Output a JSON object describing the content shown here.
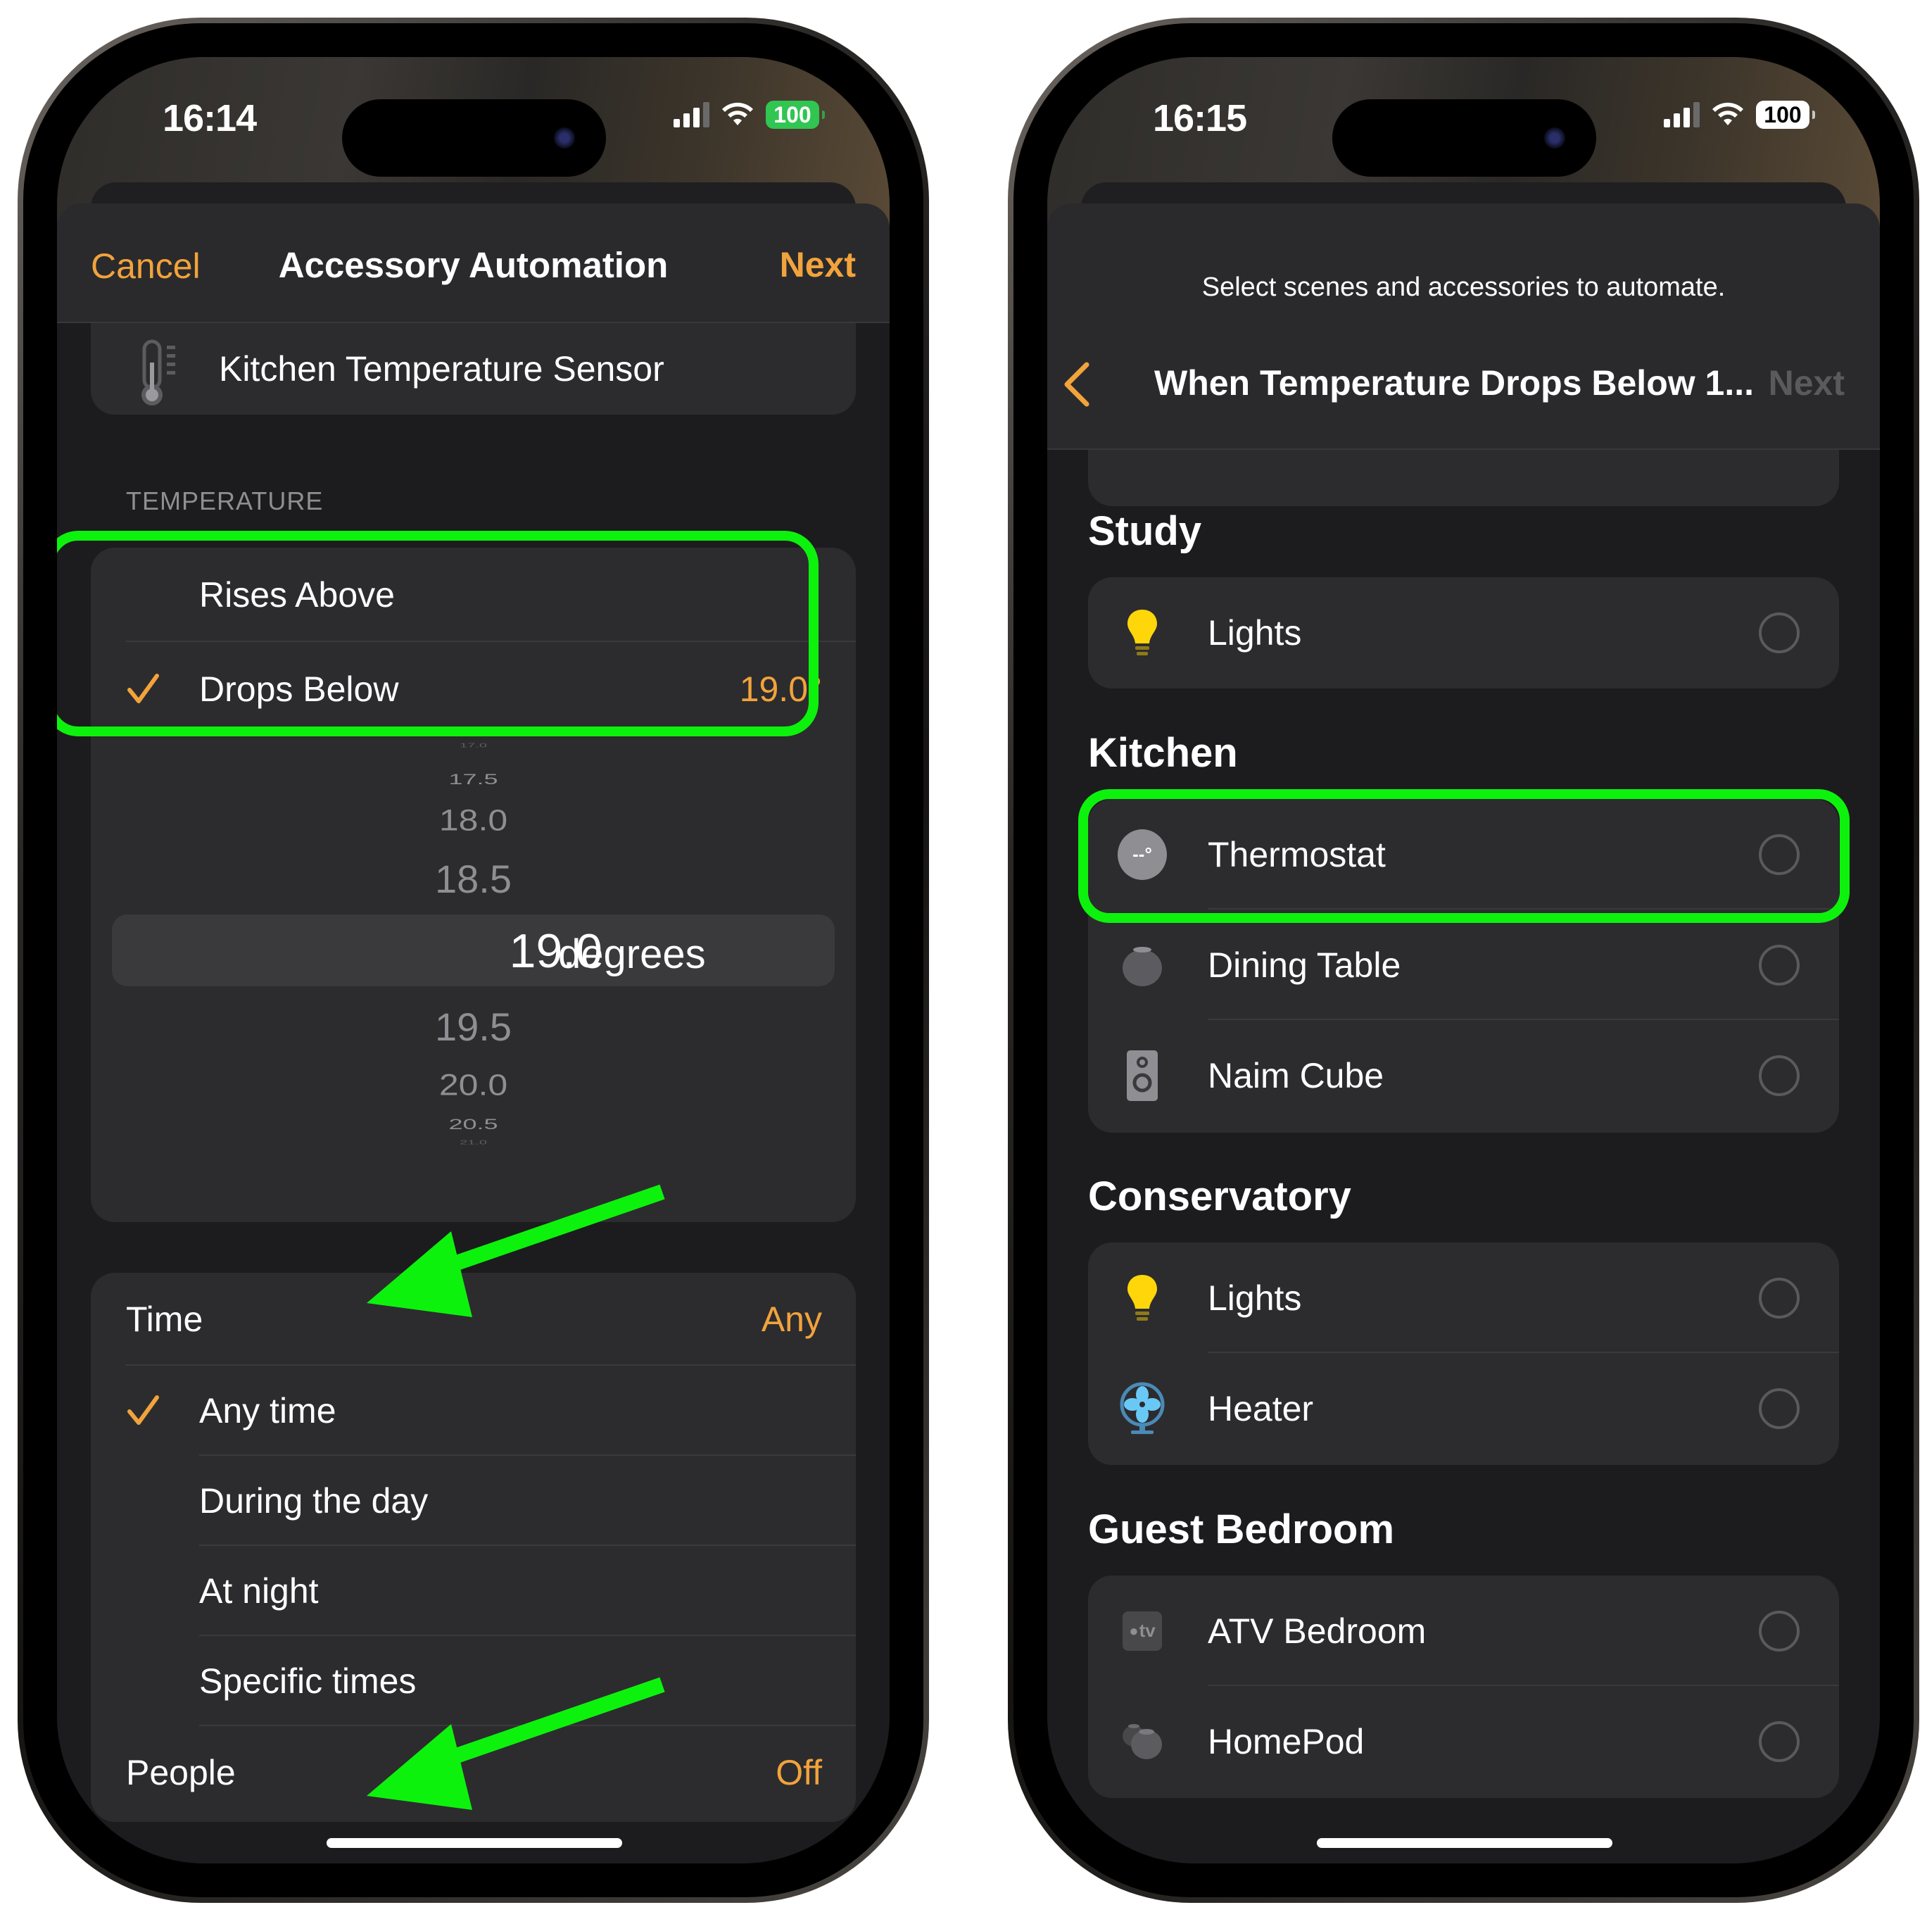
{
  "left_phone": {
    "status_bar": {
      "time": "16:14",
      "battery": "100"
    },
    "nav": {
      "cancel": "Cancel",
      "title": "Accessory Automation",
      "next": "Next"
    },
    "accessory": {
      "name": "Kitchen Temperature Sensor",
      "icon": "thermometer-icon"
    },
    "temperature": {
      "section_label": "TEMPERATURE",
      "options": [
        {
          "label": "Rises Above",
          "selected": false,
          "value": ""
        },
        {
          "label": "Drops Below",
          "selected": true,
          "value": "19.0°"
        }
      ],
      "picker": {
        "values": [
          "17.0",
          "17.5",
          "18.0",
          "18.5",
          "19.0",
          "19.5",
          "20.0",
          "20.5",
          "21.0"
        ],
        "selected": "19.0",
        "unit": "degrees"
      }
    },
    "time": {
      "label": "Time",
      "value": "Any",
      "options": [
        {
          "label": "Any time",
          "selected": true
        },
        {
          "label": "During the day",
          "selected": false
        },
        {
          "label": "At night",
          "selected": false
        },
        {
          "label": "Specific times",
          "selected": false
        }
      ]
    },
    "people": {
      "label": "People",
      "value": "Off"
    }
  },
  "right_phone": {
    "status_bar": {
      "time": "16:15",
      "battery": "100"
    },
    "subtitle": "Select scenes and accessories to automate.",
    "nav": {
      "title": "When Temperature Drops Below 1...",
      "next": "Next"
    },
    "partial_item": {
      "label": "HomePod"
    },
    "rooms": [
      {
        "name": "Study",
        "items": [
          {
            "label": "Lights",
            "icon": "lightbulb-icon",
            "selected": false
          }
        ]
      },
      {
        "name": "Kitchen",
        "items": [
          {
            "label": "Thermostat",
            "icon": "thermostat-icon",
            "icon_text": "--°",
            "selected": false
          },
          {
            "label": "Dining Table",
            "icon": "homepod-mini-icon",
            "selected": false
          },
          {
            "label": "Naim Cube",
            "icon": "speaker-icon",
            "selected": false
          }
        ]
      },
      {
        "name": "Conservatory",
        "items": [
          {
            "label": "Lights",
            "icon": "lightbulb-icon",
            "selected": false
          },
          {
            "label": "Heater",
            "icon": "fan-icon",
            "selected": false
          }
        ]
      },
      {
        "name": "Guest Bedroom",
        "items": [
          {
            "label": "ATV Bedroom",
            "icon": "apple-tv-icon",
            "icon_text": "tv",
            "selected": false
          },
          {
            "label": "HomePod",
            "icon": "homepod-pair-icon",
            "selected": false
          }
        ]
      }
    ]
  },
  "colors": {
    "accent": "#f1a33c",
    "highlight": "#0df20d",
    "background": "#1c1c1e",
    "card": "#2c2c2e"
  }
}
